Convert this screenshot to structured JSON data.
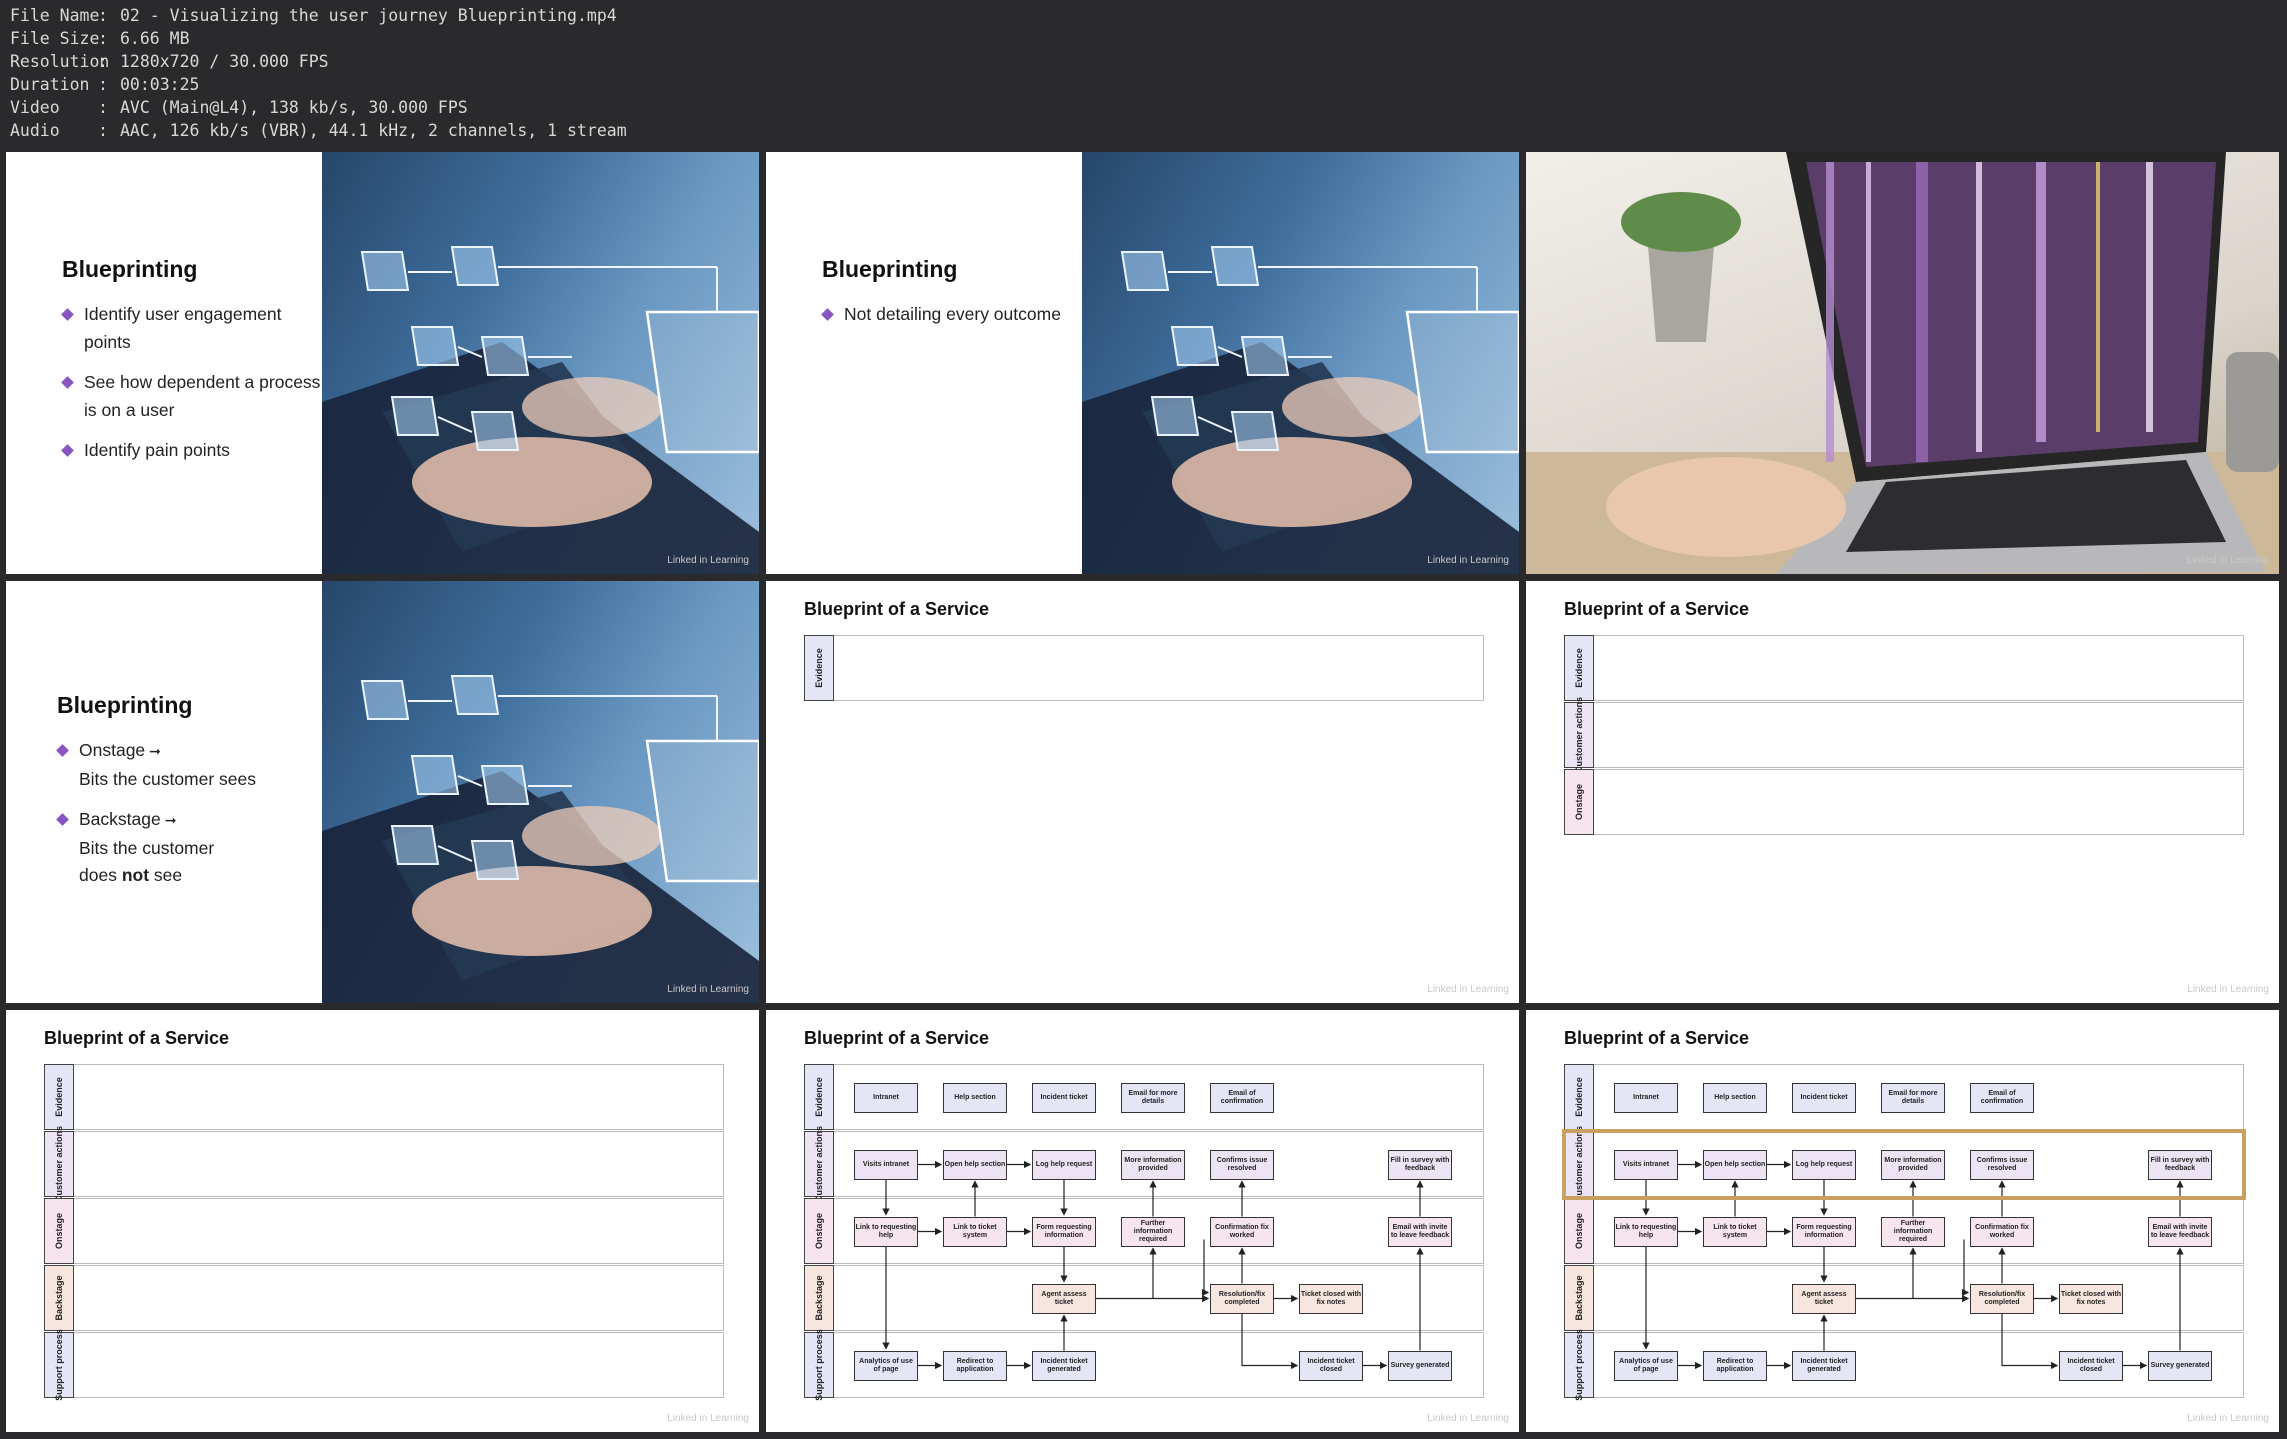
{
  "file_info": [
    {
      "key": "File Name",
      "value": "02 - Visualizing the user journey Blueprinting.mp4"
    },
    {
      "key": "File Size",
      "value": "6.66 MB"
    },
    {
      "key": "Resolution",
      "value": "1280x720 / 30.000 FPS"
    },
    {
      "key": "Duration",
      "value": "00:03:25"
    },
    {
      "key": "Video",
      "value": "AVC (Main@L4), 138 kb/s, 30.000 FPS"
    },
    {
      "key": "Audio",
      "value": "AAC, 126 kb/s (VBR), 44.1 kHz, 2 channels, 1 stream"
    }
  ],
  "separator": ":",
  "watermark": "Linked in Learning",
  "slide1": {
    "title": "Blueprinting",
    "bullets": [
      "Identify user engagement points",
      "See how dependent a process is on a user",
      "Identify pain points"
    ]
  },
  "slide2": {
    "title": "Blueprinting",
    "bullets": [
      "Not detailing every outcome"
    ]
  },
  "slide4": {
    "title": "Blueprinting",
    "b1_main": "Onstage",
    "b1_sub": "Bits the customer sees",
    "b2_main": "Backstage",
    "b2_sub_a": "Bits the customer",
    "b2_sub_b": "does",
    "b2_sub_bold": "not",
    "b2_sub_c": "see",
    "arrow": "➞"
  },
  "blueprint": {
    "heading": "Blueprint of a Service",
    "lanes": [
      "Evidence",
      "Customer actions",
      "Onstage",
      "Backstage",
      "Support process"
    ],
    "lane_colors": [
      "#e4e6f6",
      "#ece4f4",
      "#f6e4ee",
      "#f7e6df",
      "#e4e6f6"
    ],
    "evidence_nodes": [
      "Intranet",
      "Help section",
      "Incident ticket",
      "Email for more details",
      "Email of confirmation"
    ],
    "customer_nodes": [
      "Visits intranet",
      "Open help section",
      "Log help request",
      "More information provided",
      "Confirms issue resolved",
      "Fill in survey with feedback"
    ],
    "onstage_nodes": [
      "Link to requesting help",
      "Link to ticket system",
      "Form requesting information",
      "Further information required",
      "Confirmation fix worked",
      "Email with invite to leave feedback"
    ],
    "backstage_nodes": [
      "Agent assess ticket",
      "Resolution/fix completed",
      "Ticket closed with fix notes"
    ],
    "support_nodes": [
      "Analytics of use of page",
      "Redirect to application",
      "Incident ticket generated",
      "Incident ticket closed",
      "Survey generated"
    ]
  },
  "colors": {
    "accent_purple": "#8a55c0",
    "highlight": "#c9a060",
    "background": "#2a2a2c"
  }
}
